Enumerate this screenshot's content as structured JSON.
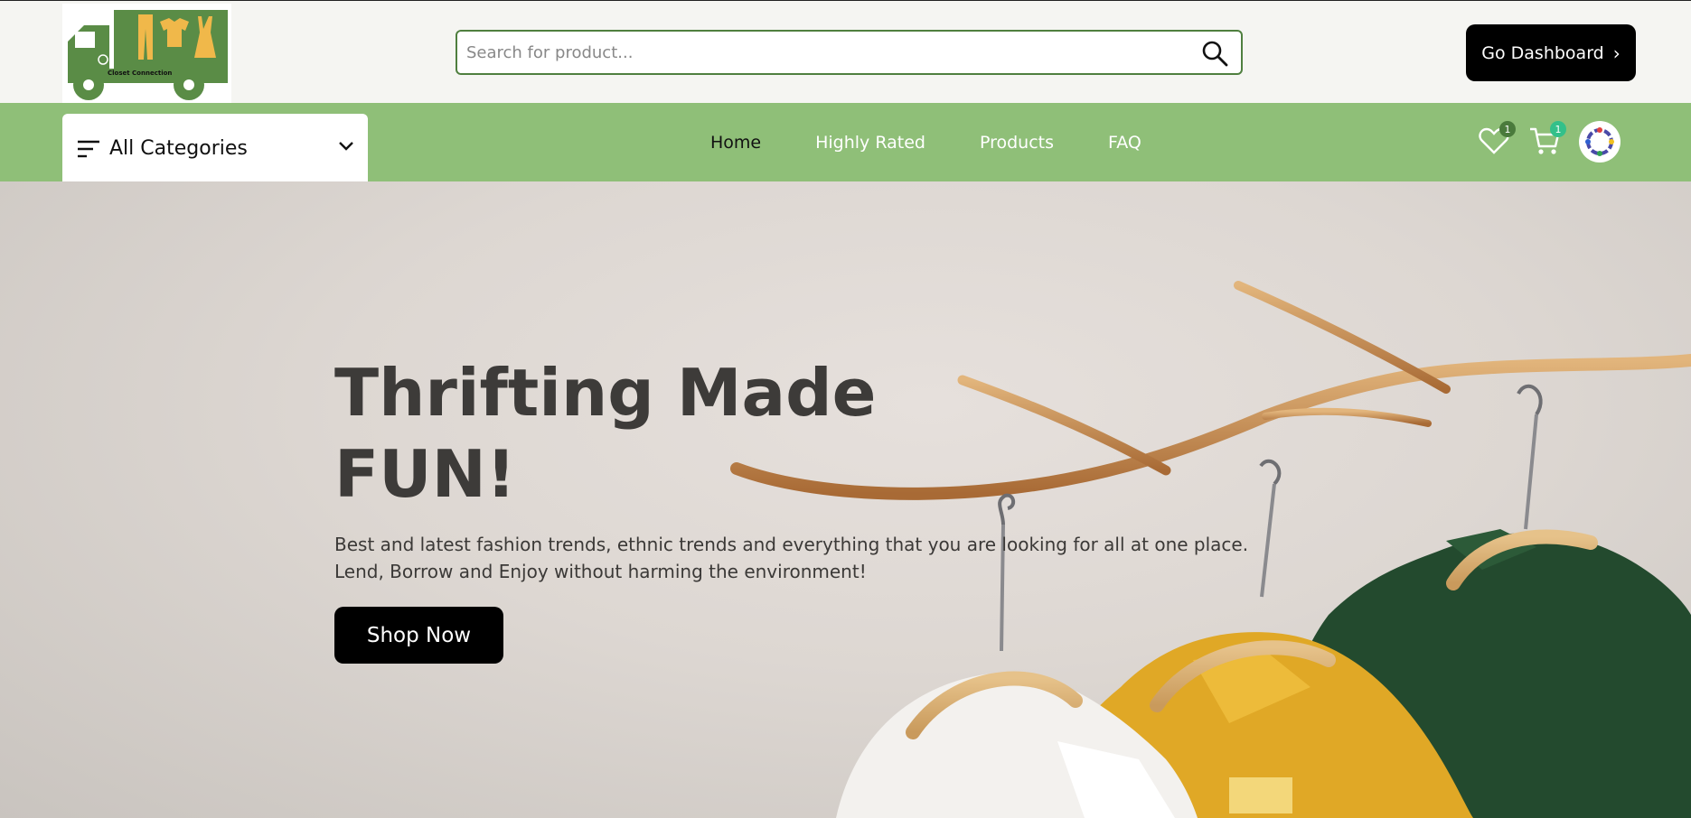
{
  "header": {
    "logo_text": "Closet Connection",
    "search_placeholder": "Search for product...",
    "dashboard_label": "Go Dashboard",
    "dashboard_chevron": "›"
  },
  "nav": {
    "categories_label": "All Categories",
    "links": [
      {
        "label": "Home",
        "active": true
      },
      {
        "label": "Highly Rated",
        "active": false
      },
      {
        "label": "Products",
        "active": false
      },
      {
        "label": "FAQ",
        "active": false
      }
    ],
    "wishlist_count": "1",
    "cart_count": "1"
  },
  "hero": {
    "title_line1": "Thrifting Made",
    "title_line2": "FUN!",
    "text_line1": "Best and latest fashion trends, ethnic trends and everything that you are looking for all at one place.",
    "text_line2": "Lend, Borrow and Enjoy without harming the environment!",
    "cta_label": "Shop Now"
  },
  "colors": {
    "brand_green": "#8fbf78",
    "logo_green": "#5a8c46",
    "accent_badge_dark": "#4a7a3c",
    "accent_badge_light": "#33c08a"
  },
  "icons": [
    "search-icon",
    "menu-lines-icon",
    "chevron-down-icon",
    "heart-icon",
    "cart-icon",
    "chevron-right-icon"
  ]
}
